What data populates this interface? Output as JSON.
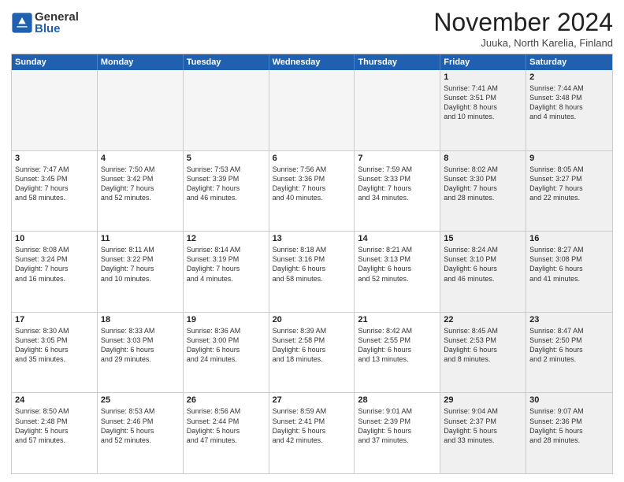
{
  "logo": {
    "general": "General",
    "blue": "Blue"
  },
  "title": "November 2024",
  "subtitle": "Juuka, North Karelia, Finland",
  "header_days": [
    "Sunday",
    "Monday",
    "Tuesday",
    "Wednesday",
    "Thursday",
    "Friday",
    "Saturday"
  ],
  "rows": [
    [
      {
        "day": "",
        "info": "",
        "empty": true
      },
      {
        "day": "",
        "info": "",
        "empty": true
      },
      {
        "day": "",
        "info": "",
        "empty": true
      },
      {
        "day": "",
        "info": "",
        "empty": true
      },
      {
        "day": "",
        "info": "",
        "empty": true
      },
      {
        "day": "1",
        "info": "Sunrise: 7:41 AM\nSunset: 3:51 PM\nDaylight: 8 hours\nand 10 minutes.",
        "empty": false,
        "shaded": true
      },
      {
        "day": "2",
        "info": "Sunrise: 7:44 AM\nSunset: 3:48 PM\nDaylight: 8 hours\nand 4 minutes.",
        "empty": false,
        "shaded": true
      }
    ],
    [
      {
        "day": "3",
        "info": "Sunrise: 7:47 AM\nSunset: 3:45 PM\nDaylight: 7 hours\nand 58 minutes.",
        "empty": false,
        "shaded": false
      },
      {
        "day": "4",
        "info": "Sunrise: 7:50 AM\nSunset: 3:42 PM\nDaylight: 7 hours\nand 52 minutes.",
        "empty": false,
        "shaded": false
      },
      {
        "day": "5",
        "info": "Sunrise: 7:53 AM\nSunset: 3:39 PM\nDaylight: 7 hours\nand 46 minutes.",
        "empty": false,
        "shaded": false
      },
      {
        "day": "6",
        "info": "Sunrise: 7:56 AM\nSunset: 3:36 PM\nDaylight: 7 hours\nand 40 minutes.",
        "empty": false,
        "shaded": false
      },
      {
        "day": "7",
        "info": "Sunrise: 7:59 AM\nSunset: 3:33 PM\nDaylight: 7 hours\nand 34 minutes.",
        "empty": false,
        "shaded": false
      },
      {
        "day": "8",
        "info": "Sunrise: 8:02 AM\nSunset: 3:30 PM\nDaylight: 7 hours\nand 28 minutes.",
        "empty": false,
        "shaded": true
      },
      {
        "day": "9",
        "info": "Sunrise: 8:05 AM\nSunset: 3:27 PM\nDaylight: 7 hours\nand 22 minutes.",
        "empty": false,
        "shaded": true
      }
    ],
    [
      {
        "day": "10",
        "info": "Sunrise: 8:08 AM\nSunset: 3:24 PM\nDaylight: 7 hours\nand 16 minutes.",
        "empty": false,
        "shaded": false
      },
      {
        "day": "11",
        "info": "Sunrise: 8:11 AM\nSunset: 3:22 PM\nDaylight: 7 hours\nand 10 minutes.",
        "empty": false,
        "shaded": false
      },
      {
        "day": "12",
        "info": "Sunrise: 8:14 AM\nSunset: 3:19 PM\nDaylight: 7 hours\nand 4 minutes.",
        "empty": false,
        "shaded": false
      },
      {
        "day": "13",
        "info": "Sunrise: 8:18 AM\nSunset: 3:16 PM\nDaylight: 6 hours\nand 58 minutes.",
        "empty": false,
        "shaded": false
      },
      {
        "day": "14",
        "info": "Sunrise: 8:21 AM\nSunset: 3:13 PM\nDaylight: 6 hours\nand 52 minutes.",
        "empty": false,
        "shaded": false
      },
      {
        "day": "15",
        "info": "Sunrise: 8:24 AM\nSunset: 3:10 PM\nDaylight: 6 hours\nand 46 minutes.",
        "empty": false,
        "shaded": true
      },
      {
        "day": "16",
        "info": "Sunrise: 8:27 AM\nSunset: 3:08 PM\nDaylight: 6 hours\nand 41 minutes.",
        "empty": false,
        "shaded": true
      }
    ],
    [
      {
        "day": "17",
        "info": "Sunrise: 8:30 AM\nSunset: 3:05 PM\nDaylight: 6 hours\nand 35 minutes.",
        "empty": false,
        "shaded": false
      },
      {
        "day": "18",
        "info": "Sunrise: 8:33 AM\nSunset: 3:03 PM\nDaylight: 6 hours\nand 29 minutes.",
        "empty": false,
        "shaded": false
      },
      {
        "day": "19",
        "info": "Sunrise: 8:36 AM\nSunset: 3:00 PM\nDaylight: 6 hours\nand 24 minutes.",
        "empty": false,
        "shaded": false
      },
      {
        "day": "20",
        "info": "Sunrise: 8:39 AM\nSunset: 2:58 PM\nDaylight: 6 hours\nand 18 minutes.",
        "empty": false,
        "shaded": false
      },
      {
        "day": "21",
        "info": "Sunrise: 8:42 AM\nSunset: 2:55 PM\nDaylight: 6 hours\nand 13 minutes.",
        "empty": false,
        "shaded": false
      },
      {
        "day": "22",
        "info": "Sunrise: 8:45 AM\nSunset: 2:53 PM\nDaylight: 6 hours\nand 8 minutes.",
        "empty": false,
        "shaded": true
      },
      {
        "day": "23",
        "info": "Sunrise: 8:47 AM\nSunset: 2:50 PM\nDaylight: 6 hours\nand 2 minutes.",
        "empty": false,
        "shaded": true
      }
    ],
    [
      {
        "day": "24",
        "info": "Sunrise: 8:50 AM\nSunset: 2:48 PM\nDaylight: 5 hours\nand 57 minutes.",
        "empty": false,
        "shaded": false
      },
      {
        "day": "25",
        "info": "Sunrise: 8:53 AM\nSunset: 2:46 PM\nDaylight: 5 hours\nand 52 minutes.",
        "empty": false,
        "shaded": false
      },
      {
        "day": "26",
        "info": "Sunrise: 8:56 AM\nSunset: 2:44 PM\nDaylight: 5 hours\nand 47 minutes.",
        "empty": false,
        "shaded": false
      },
      {
        "day": "27",
        "info": "Sunrise: 8:59 AM\nSunset: 2:41 PM\nDaylight: 5 hours\nand 42 minutes.",
        "empty": false,
        "shaded": false
      },
      {
        "day": "28",
        "info": "Sunrise: 9:01 AM\nSunset: 2:39 PM\nDaylight: 5 hours\nand 37 minutes.",
        "empty": false,
        "shaded": false
      },
      {
        "day": "29",
        "info": "Sunrise: 9:04 AM\nSunset: 2:37 PM\nDaylight: 5 hours\nand 33 minutes.",
        "empty": false,
        "shaded": true
      },
      {
        "day": "30",
        "info": "Sunrise: 9:07 AM\nSunset: 2:36 PM\nDaylight: 5 hours\nand 28 minutes.",
        "empty": false,
        "shaded": true
      }
    ]
  ]
}
